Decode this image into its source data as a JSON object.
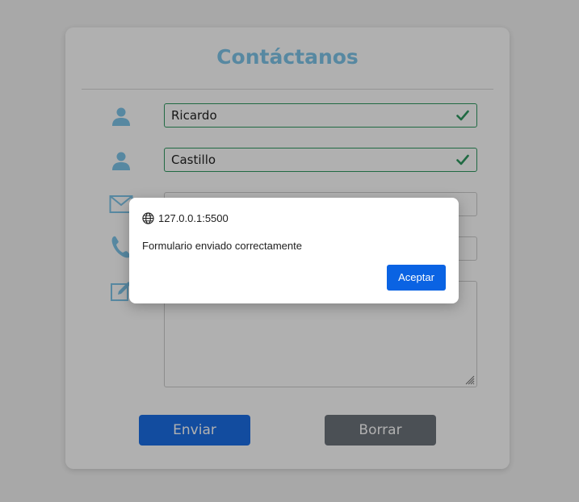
{
  "form": {
    "title": "Contáctanos",
    "fields": {
      "first_name": {
        "value": "Ricardo",
        "valid": true,
        "icon": "user-icon"
      },
      "last_name": {
        "value": "Castillo",
        "valid": true,
        "icon": "user-icon"
      },
      "email": {
        "value": "",
        "icon": "envelope-icon"
      },
      "phone": {
        "value": "",
        "icon": "phone-icon"
      },
      "message": {
        "value": "",
        "icon": "edit-icon"
      }
    },
    "buttons": {
      "send_label": "Enviar",
      "clear_label": "Borrar"
    }
  },
  "dialog": {
    "origin": "127.0.0.1:5500",
    "message": "Formulario enviado correctamente",
    "ok_label": "Aceptar"
  },
  "colors": {
    "title": "#7ec6ea",
    "icon": "#7ec6ea",
    "valid_border": "#2f9a62",
    "send_button": "#1b6fe6",
    "clear_button": "#6d747c",
    "dialog_button": "#0a63e3"
  }
}
